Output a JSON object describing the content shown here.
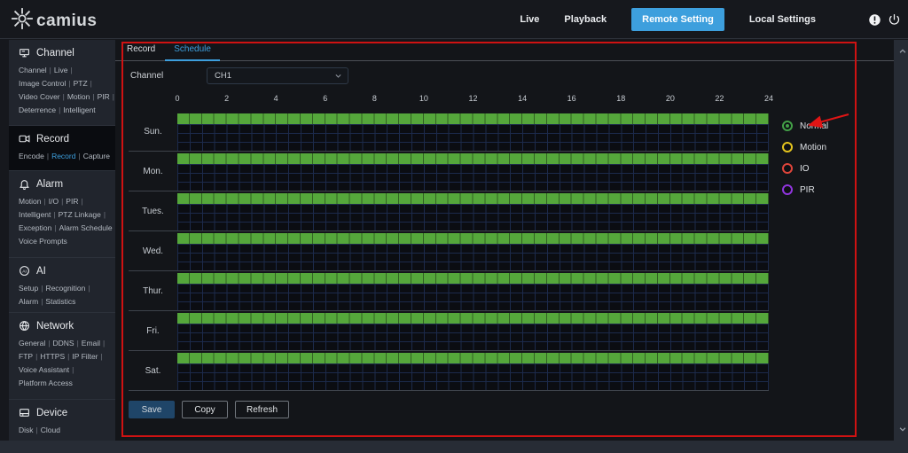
{
  "header": {
    "logo": "camius",
    "nav": [
      {
        "label": "Live",
        "active": false
      },
      {
        "label": "Playback",
        "active": false
      },
      {
        "label": "Remote Setting",
        "active": true
      },
      {
        "label": "Local Settings",
        "active": false
      }
    ],
    "icons": [
      "alert-icon",
      "power-icon"
    ]
  },
  "colors": {
    "accent_blue": "#3d9fdd",
    "schedule_green": "#55a73b",
    "annotation_red": "#cf1212",
    "save_button": "#1f4568"
  },
  "sidebar": {
    "sections": [
      {
        "title": "Channel",
        "icon": "channel-icon",
        "active": false,
        "lines": [
          {
            "items": [
              {
                "label": "Channel"
              },
              {
                "label": "Live"
              }
            ],
            "trail": true
          },
          {
            "items": [
              {
                "label": "Image Control"
              },
              {
                "label": "PTZ"
              }
            ],
            "trail": true
          },
          {
            "items": [
              {
                "label": "Video Cover"
              },
              {
                "label": "Motion"
              },
              {
                "label": "PIR"
              }
            ],
            "trail": true
          },
          {
            "items": [
              {
                "label": "Deterrence"
              },
              {
                "label": "Intelligent"
              }
            ],
            "trail": false
          }
        ]
      },
      {
        "title": "Record",
        "icon": "record-icon",
        "active": true,
        "lines": [
          {
            "items": [
              {
                "label": "Encode"
              },
              {
                "label": "Record",
                "active": true
              },
              {
                "label": "Capture"
              }
            ],
            "trail": false
          }
        ]
      },
      {
        "title": "Alarm",
        "icon": "alarm-icon",
        "active": false,
        "lines": [
          {
            "items": [
              {
                "label": "Motion"
              },
              {
                "label": "I/O"
              },
              {
                "label": "PIR"
              }
            ],
            "trail": true
          },
          {
            "items": [
              {
                "label": "Intelligent"
              },
              {
                "label": "PTZ Linkage"
              }
            ],
            "trail": true
          },
          {
            "items": [
              {
                "label": "Exception"
              },
              {
                "label": "Alarm Schedule"
              }
            ],
            "trail": true
          },
          {
            "items": [
              {
                "label": "Voice Prompts"
              }
            ],
            "trail": false
          }
        ]
      },
      {
        "title": "AI",
        "icon": "ai-icon",
        "active": false,
        "lines": [
          {
            "items": [
              {
                "label": "Setup"
              },
              {
                "label": "Recognition"
              }
            ],
            "trail": true
          },
          {
            "items": [
              {
                "label": "Alarm"
              },
              {
                "label": "Statistics"
              }
            ],
            "trail": false
          }
        ]
      },
      {
        "title": "Network",
        "icon": "network-icon",
        "active": false,
        "lines": [
          {
            "items": [
              {
                "label": "General"
              },
              {
                "label": "DDNS"
              },
              {
                "label": "Email"
              }
            ],
            "trail": true
          },
          {
            "items": [
              {
                "label": "FTP"
              },
              {
                "label": "HTTPS"
              },
              {
                "label": "IP Filter"
              }
            ],
            "trail": true
          },
          {
            "items": [
              {
                "label": "Voice Assistant"
              }
            ],
            "trail": true
          },
          {
            "items": [
              {
                "label": "Platform Access"
              }
            ],
            "trail": false
          }
        ]
      },
      {
        "title": "Device",
        "icon": "device-icon",
        "active": false,
        "lines": [
          {
            "items": [
              {
                "label": "Disk"
              },
              {
                "label": "Cloud"
              }
            ],
            "trail": false
          }
        ]
      }
    ]
  },
  "main": {
    "tabs": [
      {
        "label": "Record",
        "active": false
      },
      {
        "label": "Schedule",
        "active": true
      }
    ],
    "channel_label": "Channel",
    "channel_value": "CH1",
    "schedule": {
      "hours": [
        "0",
        "2",
        "4",
        "6",
        "8",
        "10",
        "12",
        "14",
        "16",
        "18",
        "20",
        "22",
        "24"
      ],
      "record_types": [
        "Normal",
        "Motion",
        "IO",
        "PIR"
      ],
      "cells_per_day": 48,
      "data": [
        {
          "day": "Sun.",
          "normal": [
            [
              0,
              24
            ]
          ],
          "motion": [],
          "io": [],
          "pir": []
        },
        {
          "day": "Mon.",
          "normal": [
            [
              0,
              24
            ]
          ],
          "motion": [],
          "io": [],
          "pir": []
        },
        {
          "day": "Tues.",
          "normal": [
            [
              0,
              24
            ]
          ],
          "motion": [],
          "io": [],
          "pir": []
        },
        {
          "day": "Wed.",
          "normal": [
            [
              0,
              24
            ]
          ],
          "motion": [],
          "io": [],
          "pir": []
        },
        {
          "day": "Thur.",
          "normal": [
            [
              0,
              24
            ]
          ],
          "motion": [],
          "io": [],
          "pir": []
        },
        {
          "day": "Fri.",
          "normal": [
            [
              0,
              24
            ]
          ],
          "motion": [],
          "io": [],
          "pir": []
        },
        {
          "day": "Sat.",
          "normal": [
            [
              0,
              24
            ]
          ],
          "motion": [],
          "io": [],
          "pir": []
        }
      ]
    },
    "legend": [
      {
        "label": "Normal",
        "color": "#43a047",
        "selected": true
      },
      {
        "label": "Motion",
        "color": "#e5c41e",
        "selected": false
      },
      {
        "label": "IO",
        "color": "#df453b",
        "selected": false
      },
      {
        "label": "PIR",
        "color": "#9135de",
        "selected": false
      }
    ],
    "buttons": [
      {
        "label": "Save",
        "primary": true
      },
      {
        "label": "Copy",
        "primary": false
      },
      {
        "label": "Refresh",
        "primary": false
      }
    ]
  },
  "annotations": {
    "highlight_box_color": "#cf1212",
    "arrow_color": "#e01515",
    "arrow_points_to": "Normal"
  }
}
